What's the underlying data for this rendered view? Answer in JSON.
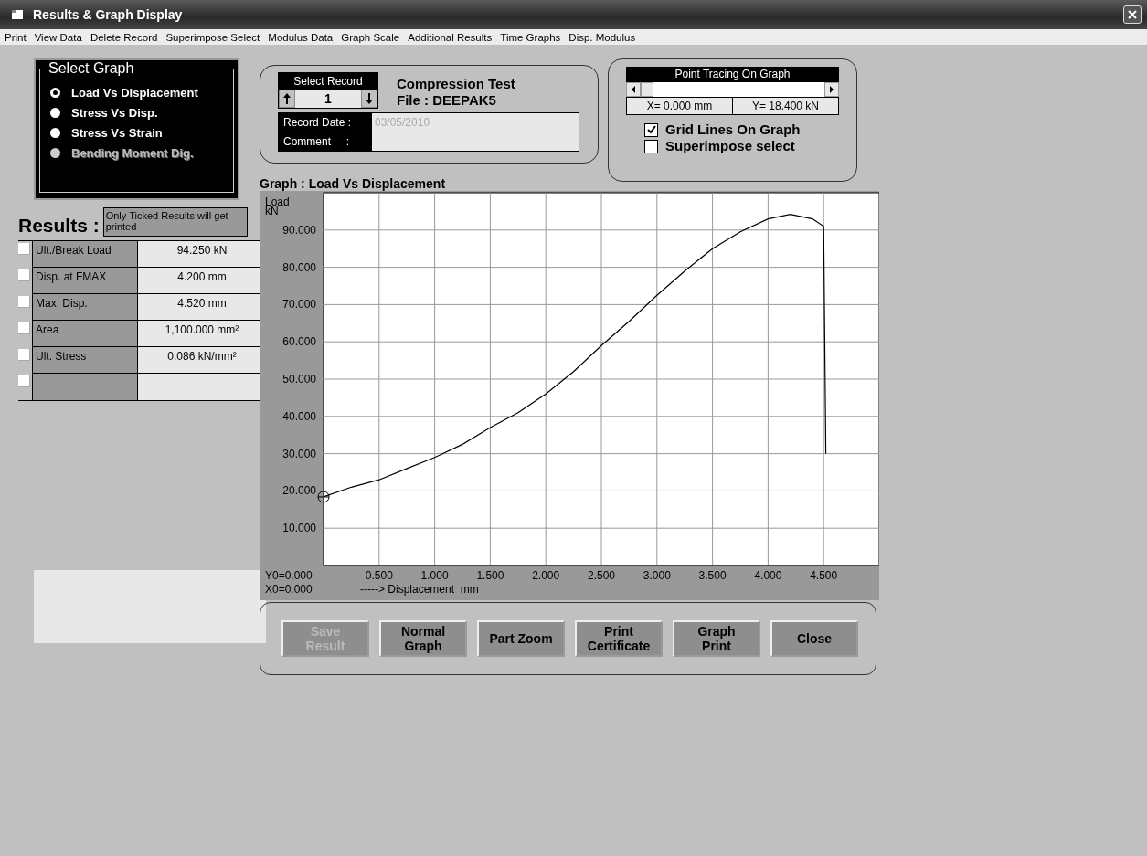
{
  "window": {
    "title": "Results & Graph Display"
  },
  "menu": [
    "Print",
    "View Data",
    "Delete Record",
    "Superimpose Select",
    "Modulus Data",
    "Graph Scale",
    "Additional Results",
    "Time Graphs",
    "Disp. Modulus"
  ],
  "select_graph": {
    "title": "Select Graph",
    "options": [
      {
        "label": "Load Vs Displacement",
        "selected": true,
        "disabled": false
      },
      {
        "label": "Stress Vs Disp.",
        "selected": false,
        "disabled": false
      },
      {
        "label": "Stress Vs Strain",
        "selected": false,
        "disabled": false
      },
      {
        "label": "Bending Moment Dig.",
        "selected": false,
        "disabled": true
      }
    ]
  },
  "results": {
    "title": "Results :",
    "note": "Only Ticked Results will get printed",
    "rows": [
      {
        "label": "Ult./Break Load",
        "value": "94.250  kN",
        "checked": false
      },
      {
        "label": "Disp. at FMAX",
        "value": "4.200  mm",
        "checked": false
      },
      {
        "label": "Max. Disp.",
        "value": "4.520  mm",
        "checked": false
      },
      {
        "label": "Area",
        "value": "1,100.000  mm²",
        "checked": false
      },
      {
        "label": "Ult. Stress",
        "value": "0.086  kN/mm²",
        "checked": false
      },
      {
        "checked": false
      }
    ]
  },
  "record": {
    "heading": "Select Record",
    "number": "1",
    "test": "Compression Test",
    "file": "File : DEEPAK5",
    "fields": [
      {
        "label": "Record Date :",
        "value": "03/05/2010"
      },
      {
        "label": "Comment     :"
      }
    ]
  },
  "tracing": {
    "title": "Point Tracing On Graph",
    "x_reading": "X= 0.000  mm",
    "y_reading": "Y= 18.400  kN",
    "options": [
      {
        "label": "Grid Lines On Graph",
        "checked": true
      },
      {
        "label": "Superimpose select",
        "checked": false
      }
    ]
  },
  "graph": {
    "title": "Graph :  Load Vs Displacement",
    "y_label": [
      "Load",
      "kN"
    ],
    "origin": [
      "Y0=0.000",
      "X0=0.000"
    ],
    "x_caption": "-----> Displacement  mm",
    "chart_data": {
      "type": "line",
      "x": [
        0,
        0.25,
        0.5,
        0.75,
        1.0,
        1.25,
        1.5,
        1.75,
        2.0,
        2.25,
        2.5,
        2.75,
        3.0,
        3.25,
        3.5,
        3.75,
        4.0,
        4.2,
        4.4,
        4.5,
        4.52
      ],
      "series": [
        {
          "color": "#000000",
          "values": [
            18.4,
            21,
            23,
            26,
            29,
            32.5,
            37,
            41,
            46,
            52,
            59,
            65.5,
            72.5,
            79,
            85,
            89.5,
            93,
            94.2,
            93,
            91,
            30
          ]
        }
      ],
      "grid": true,
      "xlim": [
        0,
        5
      ],
      "ylim": [
        0,
        100
      ],
      "xticks": [
        {
          "value": 0.5,
          "label": "0.500"
        },
        {
          "value": 1,
          "label": "1.000"
        },
        {
          "value": 1.5,
          "label": "1.500"
        },
        {
          "value": 2,
          "label": "2.000"
        },
        {
          "value": 2.5,
          "label": "2.500"
        },
        {
          "value": 3,
          "label": "3.000"
        },
        {
          "value": 3.5,
          "label": "3.500"
        },
        {
          "value": 4,
          "label": "4.000"
        },
        {
          "value": 4.5,
          "label": "4.500"
        }
      ],
      "yticks": [
        {
          "value": 10,
          "label": "10.000"
        },
        {
          "value": 20,
          "label": "20.000"
        },
        {
          "value": 30,
          "label": "30.000"
        },
        {
          "value": 40,
          "label": "40.000"
        },
        {
          "value": 50,
          "label": "50.000"
        },
        {
          "value": 60,
          "label": "60.000"
        },
        {
          "value": 70,
          "label": "70.000"
        },
        {
          "value": 80,
          "label": "80.000"
        },
        {
          "value": 90,
          "label": "90.000"
        }
      ]
    }
  },
  "buttons": [
    {
      "label": "Save\nResult",
      "disabled": true
    },
    {
      "label": "Normal\nGraph",
      "disabled": false
    },
    {
      "label": "Part Zoom",
      "disabled": false
    },
    {
      "label": "Print\nCertificate",
      "disabled": false
    },
    {
      "label": "Graph\nPrint",
      "disabled": false
    },
    {
      "label": "Close",
      "disabled": false
    }
  ]
}
